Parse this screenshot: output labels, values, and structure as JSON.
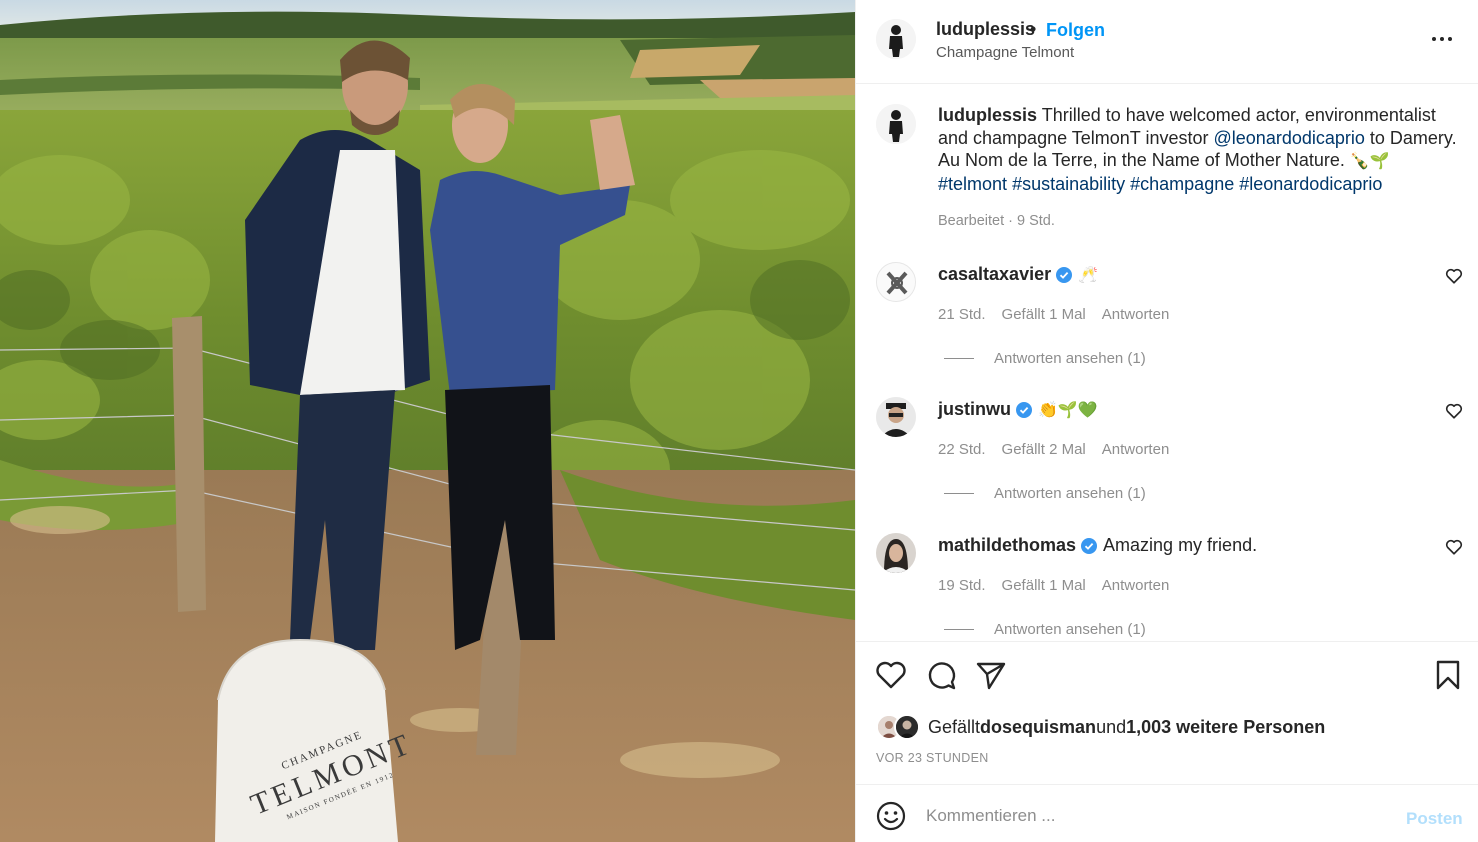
{
  "photo": {
    "alt_icon": "vineyard-photo",
    "stone_text_top": "CHAMPAGNE",
    "stone_text_brand": "TELMONT",
    "stone_text_bottom": "MAISON FONDÉE EN 1912"
  },
  "header": {
    "username": "luduplessis",
    "dot": "•",
    "follow_label": "Folgen",
    "location": "Champagne Telmont",
    "more_icon": "more-options-icon"
  },
  "caption": {
    "username": "luduplessis",
    "text_1": " Thrilled to have welcomed actor, environmentalist and champagne TelmonT investor ",
    "mention": "@leonardodicaprio",
    "text_2": " to Damery. Au Nom de la Terre, in the Name of Mother Nature. ",
    "emojis": "🍾🌱",
    "hashtags": [
      "#telmont",
      "#sustainability",
      "#champagne",
      "#leonardodicaprio"
    ],
    "meta": "Bearbeitet · 9 Std."
  },
  "comments": [
    {
      "username": "casaltaxavier",
      "verified": true,
      "text": "",
      "emojis": "🥂",
      "time": "21 Std.",
      "likes": "Gefällt 1 Mal",
      "reply_label": "Antworten",
      "view_replies": "Antworten ansehen (1)"
    },
    {
      "username": "justinwu",
      "verified": true,
      "text": "",
      "emojis": "👏🌱💚",
      "time": "22 Std.",
      "likes": "Gefällt 2 Mal",
      "reply_label": "Antworten",
      "view_replies": "Antworten ansehen (1)"
    },
    {
      "username": "mathildethomas",
      "verified": true,
      "text": "Amazing my friend.",
      "emojis": "",
      "time": "19 Std.",
      "likes": "Gefällt 1 Mal",
      "reply_label": "Antworten",
      "view_replies": "Antworten ansehen (1)"
    }
  ],
  "likes": {
    "prefix": "Gefällt ",
    "liker": "dosequisman",
    "middle": " und ",
    "count": "1,003 weitere Personen"
  },
  "timestamp": "VOR 23 STUNDEN",
  "comment_box": {
    "placeholder": "Kommentieren ...",
    "post_label": "Posten"
  },
  "colors": {
    "link": "#00376b",
    "follow": "#0095f6",
    "verified": "#3897f0",
    "muted": "#8e8e8e",
    "post_disabled": "#b2dffc"
  }
}
